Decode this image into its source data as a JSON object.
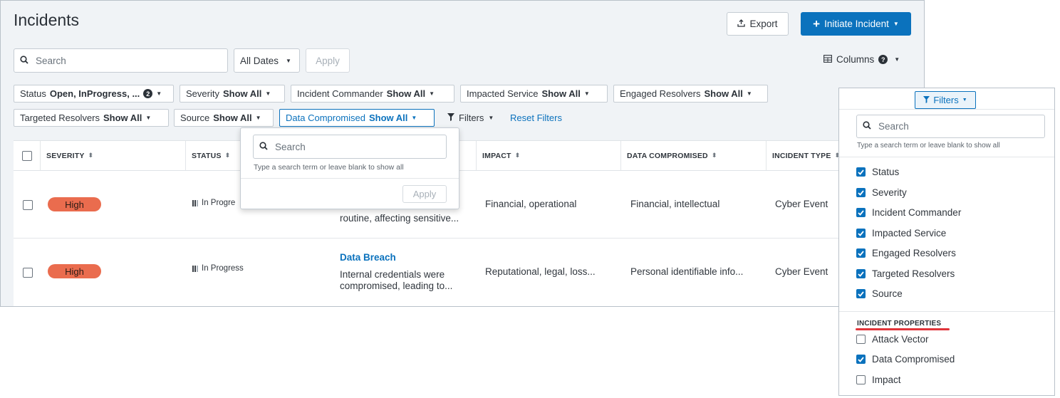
{
  "page": {
    "title": "Incidents",
    "export_label": "Export",
    "initiate_label": "Initiate Incident"
  },
  "toolbar": {
    "search_placeholder": "Search",
    "date_range": "All Dates",
    "apply_label": "Apply",
    "columns_label": "Columns",
    "columns_help": "?"
  },
  "filters": {
    "chips": [
      {
        "label": "Status",
        "value": "Open, InProgress, ...",
        "count": "2"
      },
      {
        "label": "Severity",
        "value": "Show All"
      },
      {
        "label": "Incident Commander",
        "value": "Show All"
      },
      {
        "label": "Impacted Service",
        "value": "Show All"
      },
      {
        "label": "Engaged Resolvers",
        "value": "Show All"
      },
      {
        "label": "Targeted Resolvers",
        "value": "Show All"
      },
      {
        "label": "Source",
        "value": "Show All"
      },
      {
        "label": "Data Compromised",
        "value": "Show All"
      }
    ],
    "filters_label": "Filters",
    "reset_label": "Reset Filters"
  },
  "table": {
    "columns": [
      "SEVERITY",
      "STATUS",
      "IMPACT",
      "DATA COMPROMISED",
      "INCIDENT TYPE"
    ],
    "rows": [
      {
        "severity": "High",
        "status": "In Progre",
        "desc_line2": "routine, affecting sensitive...",
        "impact": "Financial, operational",
        "data_compromised": "Financial, intellectual",
        "incident_type": "Cyber Event"
      },
      {
        "severity": "High",
        "status": "In Progress",
        "title": "Data Breach",
        "desc_line1": "Internal credentials were",
        "desc_line2": "compromised, leading to...",
        "impact": "Reputational, legal, loss...",
        "data_compromised": "Personal identifiable info...",
        "incident_type": "Cyber Event"
      }
    ]
  },
  "popover": {
    "search_placeholder": "Search",
    "hint": "Type a search term or leave blank to show all",
    "apply_label": "Apply"
  },
  "filter_panel": {
    "button_label": "Filters",
    "search_placeholder": "Search",
    "hint": "Type a search term or leave blank to show all",
    "items": [
      {
        "label": "Status",
        "checked": true
      },
      {
        "label": "Severity",
        "checked": true
      },
      {
        "label": "Incident Commander",
        "checked": true
      },
      {
        "label": "Impacted Service",
        "checked": true
      },
      {
        "label": "Engaged Resolvers",
        "checked": true
      },
      {
        "label": "Targeted Resolvers",
        "checked": true
      },
      {
        "label": "Source",
        "checked": true
      }
    ],
    "section_title": "INCIDENT PROPERTIES",
    "section_items": [
      {
        "label": "Attack Vector",
        "checked": false
      },
      {
        "label": "Data Compromised",
        "checked": true
      },
      {
        "label": "Impact",
        "checked": false
      }
    ]
  },
  "colors": {
    "primary": "#0b72bd",
    "severity_high": "#ea6c4e",
    "highlight_underline": "#e0343a",
    "page_bg": "#f0f3f6"
  }
}
